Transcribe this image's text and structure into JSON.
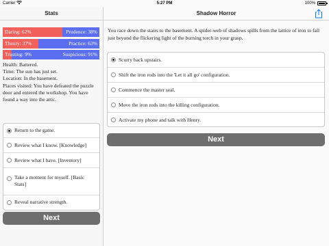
{
  "status_bar": {
    "carrier": "Carrier",
    "time": "5:27 PM",
    "battery": "100%"
  },
  "left": {
    "title": "Stats",
    "stats": [
      {
        "left": "Daring: 62%",
        "right": "Prudence: 38%",
        "pct": 62
      },
      {
        "left": "Theory: 37%",
        "right": "Practice: 63%",
        "pct": 37
      },
      {
        "left": "Trusting: 9%",
        "right": "Suspicious: 91%",
        "pct": 9
      }
    ],
    "status_lines": [
      "Health: Battered.",
      "Time: The sun has just set.",
      "Location: In the basement.",
      "Places visited: You have defeated the puzzle door and entered the workshop. You have found a way into the attic."
    ],
    "menu": [
      {
        "label": "Return to the game.",
        "selected": true
      },
      {
        "label": "Review what I know. [Knowledge]",
        "selected": false
      },
      {
        "label": "Review what I have. [Inventory]",
        "selected": false
      },
      {
        "label": "Take a moment for myself. [Basic Stats]",
        "selected": false
      },
      {
        "label": "Reveal narrative strength.",
        "selected": false
      }
    ],
    "next_label": "Next"
  },
  "right": {
    "title": "Shadow Horror",
    "passage": "You race down the stairs to the basement. A spider-web of shadows spills from the lattice of iron to fall just beyond the flickering light of the burning torch in your grasp.",
    "choices": [
      {
        "label": "Scurry back upstairs.",
        "selected": true
      },
      {
        "label": "Shift the iron rods into the 'Let it all go' configuration.",
        "selected": false
      },
      {
        "label": "Commence the master seal.",
        "selected": false
      },
      {
        "label": "Move the iron rods into the killing configuration.",
        "selected": false
      },
      {
        "label": "Activate my phone and talk with Henry.",
        "selected": false
      }
    ],
    "next_label": "Next"
  },
  "colors": {
    "daring": "#f2605b",
    "prudence": "#5b6ef0",
    "button": "#6e6e6e",
    "ios_blue": "#007aff"
  },
  "icons": {
    "share": "share-icon",
    "wifi": "wifi-icon",
    "battery": "battery-icon"
  }
}
